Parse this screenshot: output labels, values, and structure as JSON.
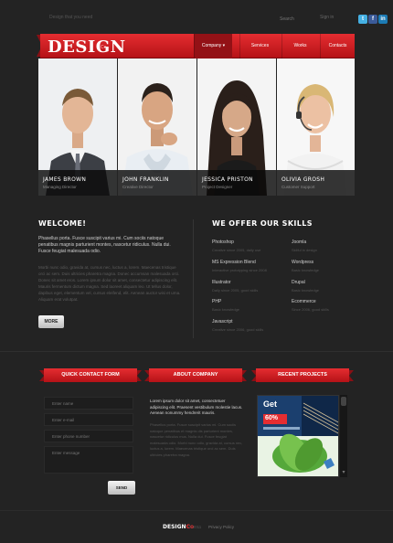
{
  "topbar": {
    "tagline": "Design that you need",
    "search_placeholder": "Search",
    "signin_label": "Sign in",
    "social": [
      {
        "icon": "twitter-icon",
        "glyph": "t",
        "color": "#45b0e3"
      },
      {
        "icon": "facebook-icon",
        "glyph": "f",
        "color": "#3b5b99"
      },
      {
        "icon": "linkedin-icon",
        "glyph": "in",
        "color": "#1c7bb4"
      }
    ]
  },
  "header": {
    "logo": "DESIGN",
    "logo_suffix": "Co",
    "accent_color": "#e52d31",
    "nav": [
      {
        "label": "Company",
        "active": true
      },
      {
        "label": "Services",
        "active": false
      },
      {
        "label": "Works",
        "active": false
      },
      {
        "label": "Contacts",
        "active": false
      }
    ]
  },
  "team": [
    {
      "name": "JAMES BROWN",
      "role": "Managing Director"
    },
    {
      "name": "JOHN FRANKLIN",
      "role": "Creative Director"
    },
    {
      "name": "JESSICA PRISTON",
      "role": "Project Designer"
    },
    {
      "name": "OLIVIA GROSH",
      "role": "Customer Support"
    }
  ],
  "welcome": {
    "title": "WELCOME!",
    "lead": "Phasellus porta. Fusce suscipit varius mi. Cum sociis natoque penatibus magnis parturient montes, nascetur ridiculus. Nulla dui. Fusce feugiat malesuada odio.",
    "body": "Morbi nunc odio, gravida at, cursus nec, luctus a, lorem. Maecenas tristique orci ac sem. Duis ultricies pharetra magna. Donec accumsan malesuada orci. Donec sit amet eros. Lorem ipsum dolor sit amet, consectetur adipiscing elit. Mauris fermentum dictum magna. Sed laoreet aliquam leo. Ut tellus dolor, dapibus eget, elementum vel, cursus eleifend, elit. Aenean auctor wisi et urna. Aliquam erat volutpat.",
    "more_label": "MORE"
  },
  "skills": {
    "title": "WE OFFER OUR SKILLS",
    "items": [
      {
        "name": "Photoshop",
        "desc": "Creative since 2005, daily use"
      },
      {
        "name": "Joomla",
        "desc": "Skilful in design"
      },
      {
        "name": "MS Expression Blend",
        "desc": "Interactive prototyping since 2008"
      },
      {
        "name": "Wordpress",
        "desc": "Basic knowledge"
      },
      {
        "name": "Illustrator",
        "desc": "Daily since 2005, good skills"
      },
      {
        "name": "Drupal",
        "desc": "Basic knowledge"
      },
      {
        "name": "PHP",
        "desc": "Basic knowledge"
      },
      {
        "name": "Ecommerce",
        "desc": "Since 2006, good skills"
      },
      {
        "name": "Javascript",
        "desc": "Creative since 2006, good skills"
      }
    ]
  },
  "contact": {
    "title": "QUICK CONTACT FORM",
    "name_placeholder": "Enter name",
    "email_placeholder": "Enter e-mail",
    "phone_placeholder": "Enter phone number",
    "message_placeholder": "Enter message",
    "send_label": "SEND"
  },
  "about": {
    "title": "ABOUT COMPANY",
    "lead": "Lorem ipsum dolor sit amet, consectetuer adipiscing elit. Praesent vestibulum molestie lacus. Aenean nonummy hendrerit mauris.",
    "body": "Phasellus porta. Fusce suscipit varius mi. Cum sociis natoque penatibus et magnis dis parturient montes, nascetur ridiculus mus. Nulla dui. Fusce feugiat malesuada odio. Morbi nunc odio, gravida at, cursus nec, luctus a, lorem. Maecenas tristique orci ac sem. Duis ultricies pharetra magna."
  },
  "projects": {
    "title": "RECENT PROJECTS",
    "card_heading": "Get",
    "card_badge": "60%"
  },
  "footer": {
    "logo": "DESIGN",
    "logo_suffix": "Co",
    "copyright": "© 2011",
    "privacy": "Privacy Policy"
  }
}
